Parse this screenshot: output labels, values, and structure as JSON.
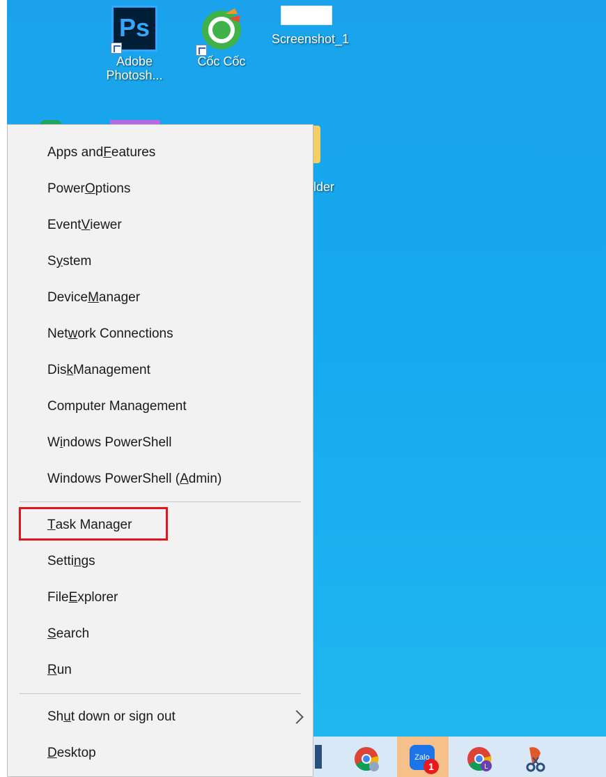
{
  "desktop": {
    "icons": [
      {
        "label_line1": "Adobe",
        "label_line2": "Photosh...",
        "icon": "photoshop-icon",
        "tile_text": "Ps"
      },
      {
        "label_line1": "Cốc Cốc",
        "label_line2": "",
        "icon": "coccoc-icon"
      },
      {
        "label_line1": "Screenshot_1",
        "label_line2": "",
        "icon": "image-file-icon"
      }
    ],
    "partial_folder_label": "older"
  },
  "menu": {
    "items": [
      {
        "pre": "Apps and ",
        "u": "F",
        "post": "eatures"
      },
      {
        "pre": "Power ",
        "u": "O",
        "post": "ptions"
      },
      {
        "pre": "Event ",
        "u": "V",
        "post": "iewer"
      },
      {
        "pre": "S",
        "u": "y",
        "post": "stem"
      },
      {
        "pre": "Device ",
        "u": "M",
        "post": "anager"
      },
      {
        "pre": "Net",
        "u": "w",
        "post": "ork Connections"
      },
      {
        "pre": "Dis",
        "u": "k",
        "post": " Management"
      },
      {
        "pre": "Computer Mana",
        "u": "g",
        "post": "ement"
      },
      {
        "pre": "W",
        "u": "i",
        "post": "ndows PowerShell"
      },
      {
        "pre": "Windows PowerShell (",
        "u": "A",
        "post": "dmin)"
      },
      {
        "pre": "",
        "u": "T",
        "post": "ask Manager"
      },
      {
        "pre": "Setti",
        "u": "n",
        "post": "gs"
      },
      {
        "pre": "File ",
        "u": "E",
        "post": "xplorer"
      },
      {
        "pre": "",
        "u": "S",
        "post": "earch"
      },
      {
        "pre": "",
        "u": "R",
        "post": "un"
      },
      {
        "pre": "Sh",
        "u": "u",
        "post": "t down or sign out"
      },
      {
        "pre": "",
        "u": "D",
        "post": "esktop"
      }
    ],
    "highlighted_item": "Task Manager",
    "highlight_color": "#e0161c"
  },
  "taskbar": {
    "zalo_badge": "1",
    "zalo_tile_text": "Zalo",
    "chrome_profile_letter": "L"
  }
}
